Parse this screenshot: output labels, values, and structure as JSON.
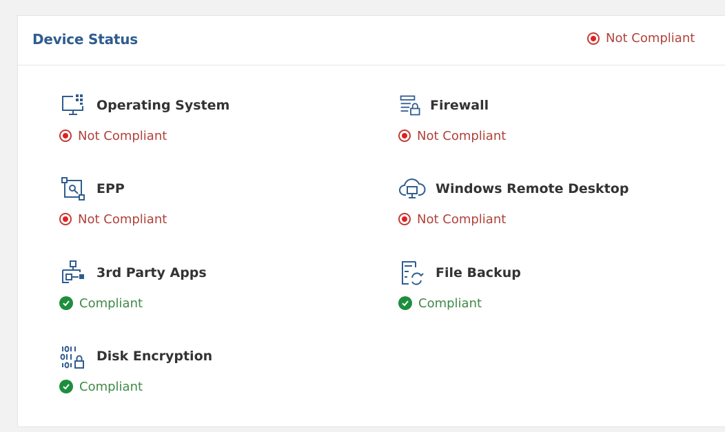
{
  "card": {
    "title": "Device Status",
    "overall_status": "Not Compliant"
  },
  "items": [
    {
      "label": "Operating System",
      "status": "Not Compliant",
      "icon": "monitor-grid-icon"
    },
    {
      "label": "Firewall",
      "status": "Not Compliant",
      "icon": "firewall-lock-icon"
    },
    {
      "label": "EPP",
      "status": "Not Compliant",
      "icon": "endpoint-protection-icon"
    },
    {
      "label": "Windows Remote Desktop",
      "status": "Not Compliant",
      "icon": "cloud-desktop-icon"
    },
    {
      "label": "3rd Party Apps",
      "status": "Compliant",
      "icon": "apps-network-icon"
    },
    {
      "label": "File Backup",
      "status": "Compliant",
      "icon": "file-backup-icon"
    },
    {
      "label": "Disk Encryption",
      "status": "Compliant",
      "icon": "binary-lock-icon"
    }
  ],
  "colors": {
    "title": "#2f5c8f",
    "icon": "#2f5c8f",
    "not_compliant_text": "#b0413a",
    "not_compliant_dot": "#e02020",
    "compliant_text": "#3f8a47",
    "compliant_check": "#1e8e3e"
  }
}
